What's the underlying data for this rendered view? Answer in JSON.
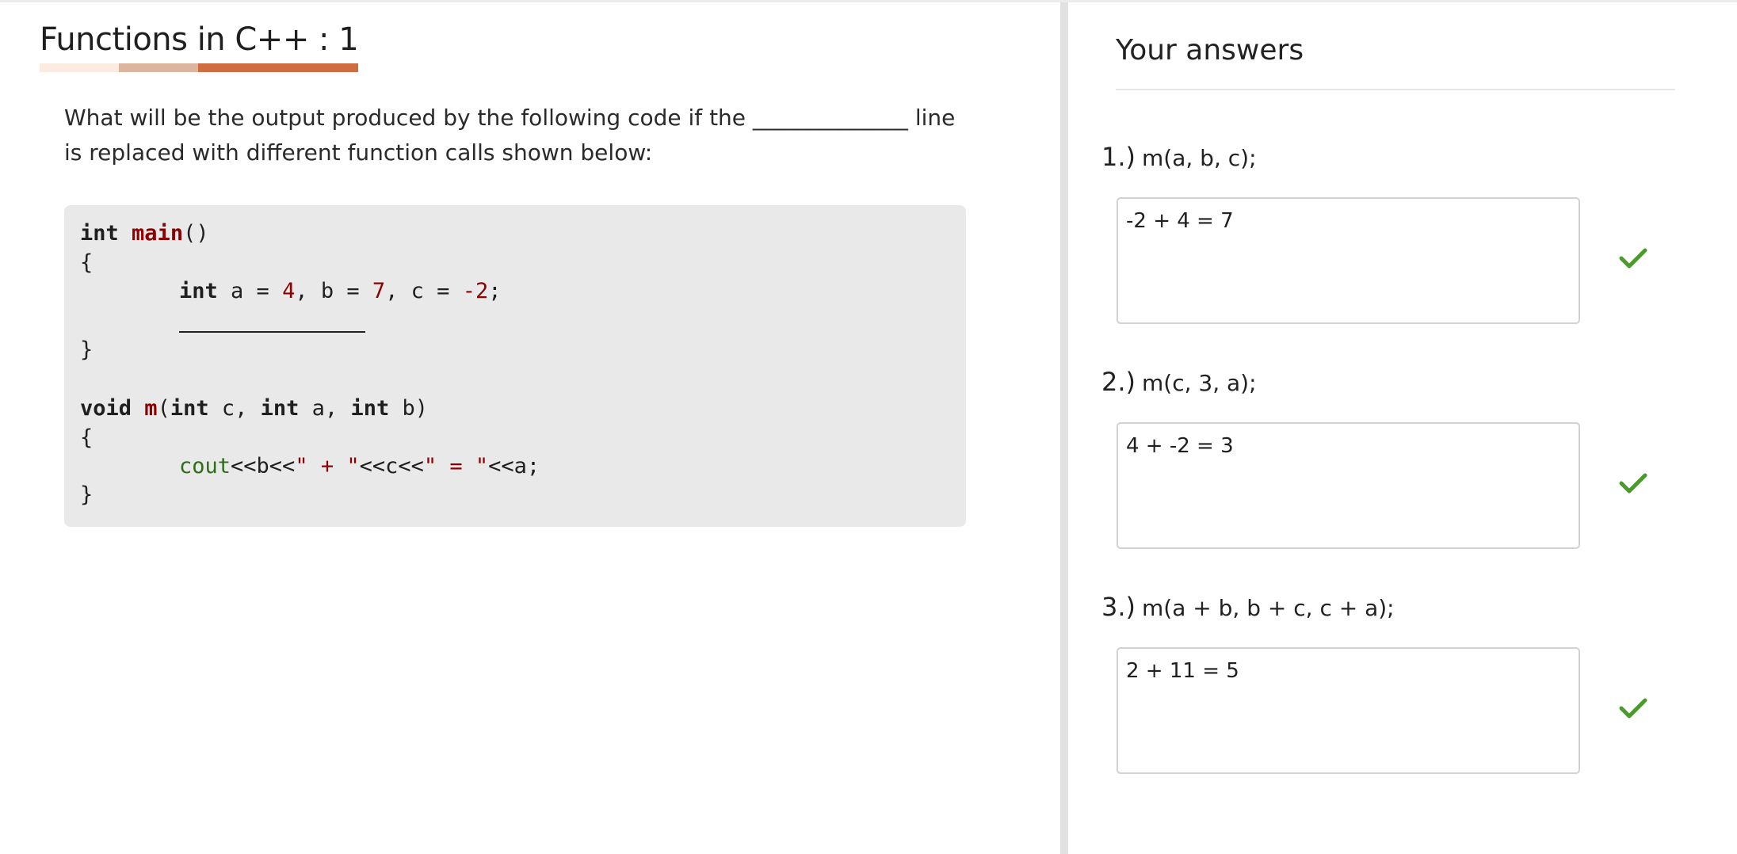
{
  "lesson": {
    "title": "Functions in C++ : 1",
    "progress_colors": [
      "#fcebe1",
      "#dcb59f",
      "#cd6d40"
    ]
  },
  "question": {
    "text": "What will be the output produced by the following code if the ______________ line is replaced with different function calls shown below:"
  },
  "code": {
    "l1_kw": "int",
    "l1_fn": "main",
    "l1_rest": "()",
    "l2": "{",
    "l3_kw": "int",
    "l3_a": " a = ",
    "l3_n1": "4",
    "l3_b": ", b = ",
    "l3_n2": "7",
    "l3_c": ", c = ",
    "l3_n3": "-2",
    "l3_end": ";",
    "l5": "}",
    "l7_kw1": "void",
    "l7_fn": "m",
    "l7_p1": "(",
    "l7_kw2": "int",
    "l7_p2": " c, ",
    "l7_kw3": "int",
    "l7_p3": " a, ",
    "l7_kw4": "int",
    "l7_p4": " b)",
    "l8": "{",
    "l9_cout": "cout",
    "l9_a": "<<b<<",
    "l9_s1": "\" + \"",
    "l9_b": "<<c<<",
    "l9_s2": "\" = \"",
    "l9_c": "<<a;",
    "l10": "}"
  },
  "answers": {
    "title": "Your answers",
    "items": [
      {
        "number": "1.)",
        "call": "m(a, b, c);",
        "answer": "-2 + 4 = 7",
        "status": "correct"
      },
      {
        "number": "2.)",
        "call": "m(c, 3, a);",
        "answer": "4 + -2 = 3",
        "status": "correct"
      },
      {
        "number": "3.)",
        "call": "m(a + b, b + c, c + a);",
        "answer": "2 + 11 = 5",
        "status": "correct"
      }
    ],
    "check_color": "#4a9a2e"
  }
}
